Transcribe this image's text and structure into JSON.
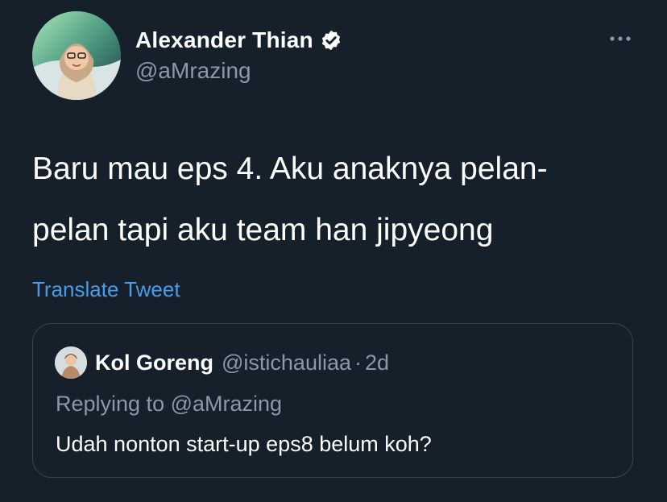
{
  "author": {
    "name": "Alexander Thian",
    "handle": "@aMrazing",
    "verified": true,
    "avatar_icon": "profile-photo-icon"
  },
  "tweet": {
    "text_lines": [
      "Baru mau eps 4. Aku anaknya pelan-",
      "pelan tapi aku team han jipyeong"
    ],
    "translate_label": "Translate Tweet"
  },
  "quoted_tweet": {
    "author_name": "Kol Goreng",
    "handle": "@istichauliaa",
    "separator": "·",
    "time": "2d",
    "replying_prefix": "Replying to",
    "replying_to": "@aMrazing",
    "text": "Udah nonton start-up eps8 belum koh?"
  },
  "icons": {
    "verified": "verified-badge-icon",
    "more": "more-options-icon"
  },
  "colors": {
    "background": "#16202b",
    "primary_text": "#ffffff",
    "secondary_text": "#8b98a5",
    "link": "#4a9be8",
    "border": "#38444d"
  }
}
